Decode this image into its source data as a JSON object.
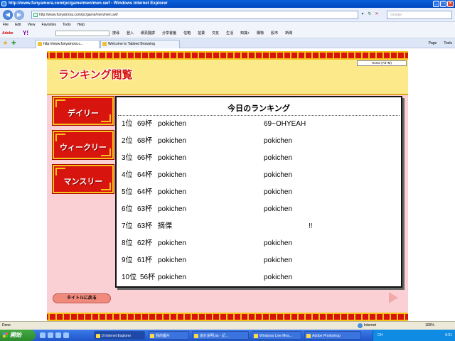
{
  "browser": {
    "window_title": "http://www.funyamora.com/pc/game/men/men.swf - Windows Internet Explorer",
    "address": "http://www.funyamora.com/pc/game/men/men.swf",
    "search_placeholder": "Google",
    "menu": [
      "File",
      "Edit",
      "View",
      "Favorites",
      "Tools",
      "Help"
    ],
    "toolbar": {
      "adobe": "Adobe",
      "yahoo": "Y!",
      "search_btn": "搜尋",
      "login": "登入",
      "links": [
        "網頁翻譯",
        "分享書籤",
        "信箱",
        "拍賣",
        "交友",
        "生活",
        "知識+",
        "購物",
        "股市",
        "新聞"
      ]
    },
    "tabs": [
      {
        "label": "http://www.funyamora.c..."
      },
      {
        "label": "Welcome to Tabbed Browsing"
      }
    ],
    "tab_tools": [
      "Page",
      "Tools"
    ],
    "status": {
      "text": "Done",
      "zone": "Internet",
      "zoom": "100%"
    }
  },
  "game": {
    "title": "ランキング閲覧",
    "home_button": "Home (Alt+M)",
    "side_buttons": [
      "デイリー",
      "ウィークリー",
      "マンスリー"
    ],
    "board_title": "今日のランキング",
    "rankings": [
      {
        "rank": "1位",
        "cups": "69杯",
        "name": "pokichen",
        "comment": "69~OHYEAH"
      },
      {
        "rank": "2位",
        "cups": "68杯",
        "name": "pokichen",
        "comment": "pokichen"
      },
      {
        "rank": "3位",
        "cups": "66杯",
        "name": "pokichen",
        "comment": "pokichen"
      },
      {
        "rank": "4位",
        "cups": "64杯",
        "name": "pokichen",
        "comment": "pokichen"
      },
      {
        "rank": "5位",
        "cups": "64杯",
        "name": "pokichen",
        "comment": "pokichen"
      },
      {
        "rank": "6位",
        "cups": "63杯",
        "name": "pokichen",
        "comment": "pokichen"
      },
      {
        "rank": "7位",
        "cups": "63杯",
        "name": "摘傈",
        "comment": "!!"
      },
      {
        "rank": "8位",
        "cups": "62杯",
        "name": "pokichen",
        "comment": "pokichen"
      },
      {
        "rank": "9位",
        "cups": "61杯",
        "name": "pokichen",
        "comment": "pokichen"
      },
      {
        "rank": "10位",
        "cups": "56杯",
        "name": "pokichen",
        "comment": "pokichen"
      }
    ],
    "back_button": "タイトルに戻る"
  },
  "taskbar": {
    "start": "開始",
    "windows": [
      "3 Internet Explorer",
      "我的圖片",
      "說計說明.txt - 記...",
      "Windows Live Mes...",
      "Adobe Photoshop"
    ],
    "lang": "CH",
    "clock": "0:51"
  }
}
